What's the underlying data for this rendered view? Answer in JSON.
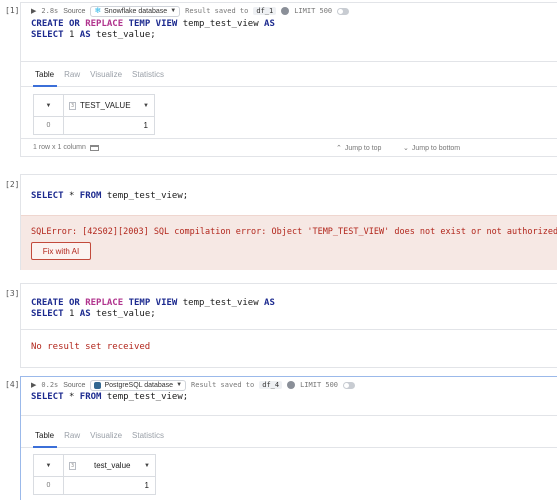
{
  "cells": [
    {
      "number": "[1]",
      "meta": {
        "duration": "2.8s",
        "source_label": "Source",
        "source_value": "Snowflake database",
        "result_saved_label": "Result saved to",
        "df_name": "df_1",
        "limit_label": "LIMIT 500"
      },
      "code": {
        "line1": {
          "kw1": "CREATE",
          "kw2": "OR",
          "kw3": "REPLACE",
          "kw4": "TEMP VIEW",
          "name": "temp_test_view",
          "kw5": "AS"
        },
        "line2": {
          "kw1": "SELECT",
          "num": "1",
          "kw2": "AS",
          "name": "test_value;"
        }
      },
      "tabs": [
        "Table",
        "Raw",
        "Visualize",
        "Statistics"
      ],
      "table": {
        "column": "TEST_VALUE",
        "type_icon": "3",
        "rows": [
          {
            "index": "0",
            "value": "1"
          }
        ]
      },
      "footer": {
        "count": "1 row x 1 column",
        "jump_top": "Jump to top",
        "jump_bottom": "Jump to bottom"
      }
    },
    {
      "number": "[2]",
      "code": {
        "kw1": "SELECT",
        "star": "*",
        "kw2": "FROM",
        "name": "temp_test_view;"
      },
      "error": {
        "message": "SQLError: [42S02][2003] SQL compilation error: Object 'TEMP_TEST_VIEW' does not exist or not authorized.",
        "fix_button": "Fix with AI"
      }
    },
    {
      "number": "[3]",
      "code": {
        "line1": {
          "kw1": "CREATE",
          "kw2": "OR",
          "kw3": "REPLACE",
          "kw4": "TEMP VIEW",
          "name": "temp_test_view",
          "kw5": "AS"
        },
        "line2": {
          "kw1": "SELECT",
          "num": "1",
          "kw2": "AS",
          "name": "test_value;"
        }
      },
      "message": "No result set received"
    },
    {
      "number": "[4]",
      "meta": {
        "duration": "0.2s",
        "source_label": "Source",
        "source_value": "PostgreSQL database",
        "result_saved_label": "Result saved to",
        "df_name": "df_4",
        "limit_label": "LIMIT 500"
      },
      "code": {
        "kw1": "SELECT",
        "star": "*",
        "kw2": "FROM",
        "name": "temp_test_view;"
      },
      "tabs": [
        "Table",
        "Raw",
        "Visualize",
        "Statistics"
      ],
      "table": {
        "column": "test_value",
        "type_icon": "3",
        "rows": [
          {
            "index": "0",
            "value": "1"
          }
        ]
      }
    }
  ],
  "colors": {
    "error": "#b2261c",
    "error_bg": "#f6e8e4",
    "accent": "#3b6fd8",
    "keyword": "#1c2a8f",
    "keyword_alt": "#b0338d"
  }
}
